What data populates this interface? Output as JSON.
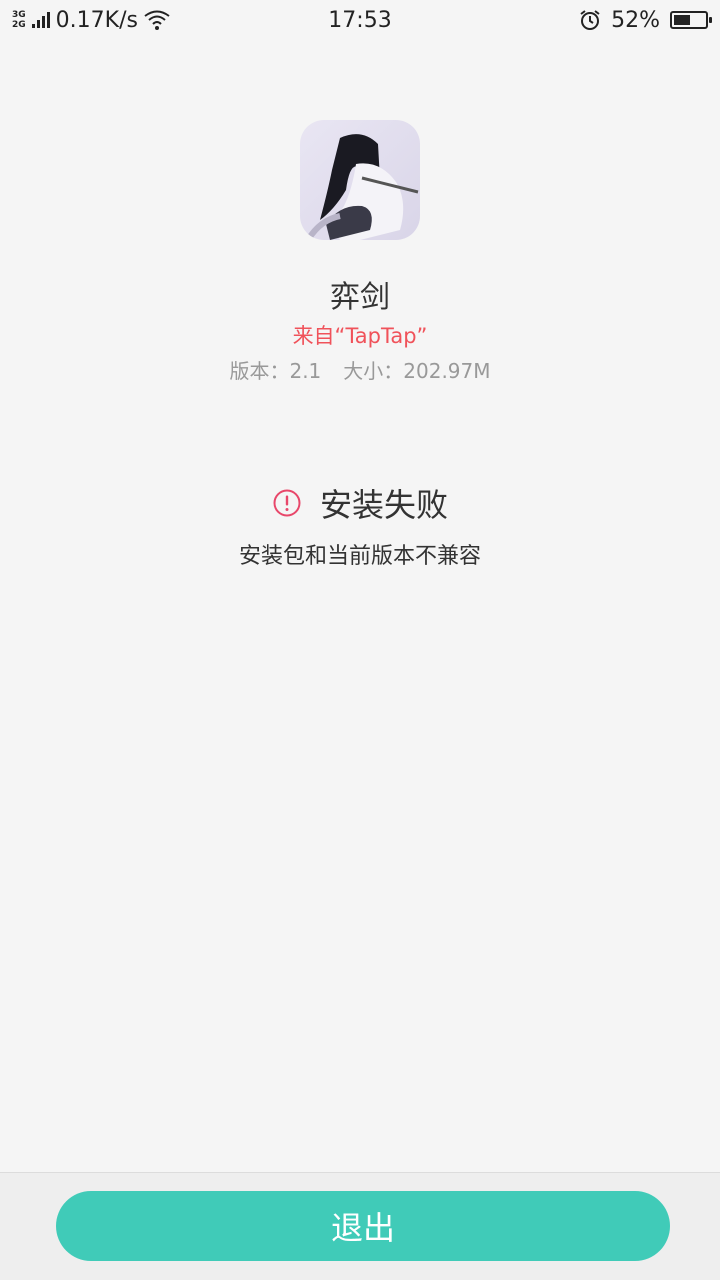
{
  "status_bar": {
    "net_type_top": "3G",
    "net_type_bottom": "2G",
    "speed": "0.17K/s",
    "time": "17:53",
    "battery": "52%",
    "icons": [
      "signal-icon",
      "wifi-icon",
      "alarm-icon",
      "battery-icon"
    ]
  },
  "app": {
    "name": "弈剑",
    "source": "来自“TapTap”",
    "version": "版本：2.1",
    "size": "大小：202.97M"
  },
  "result": {
    "title": "安装失败",
    "reason": "安装包和当前版本不兼容",
    "icon": "alert-circle-icon",
    "icon_color": "#e8476a"
  },
  "actions": {
    "exit_label": "退出",
    "accent": "#40cbb8"
  }
}
